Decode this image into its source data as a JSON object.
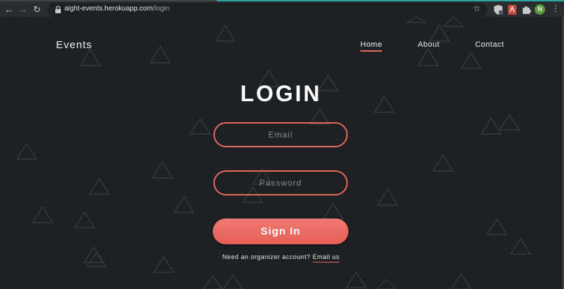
{
  "browser": {
    "url_host": "aight-events.herokuapp.com",
    "url_path": "/login",
    "avatar_letter": "N"
  },
  "nav": {
    "brand": "Events",
    "links": [
      "Home",
      "About",
      "Contact"
    ],
    "active": "Home"
  },
  "login": {
    "title": "LOGIN",
    "email_placeholder": "Email",
    "password_placeholder": "Password",
    "submit_label": "Sign In",
    "footer_text": "Need an organizer account?",
    "footer_link": "Email us"
  },
  "colors": {
    "background": "#1f2023",
    "accent": "#e66a5f",
    "button": "#ec6c64"
  }
}
